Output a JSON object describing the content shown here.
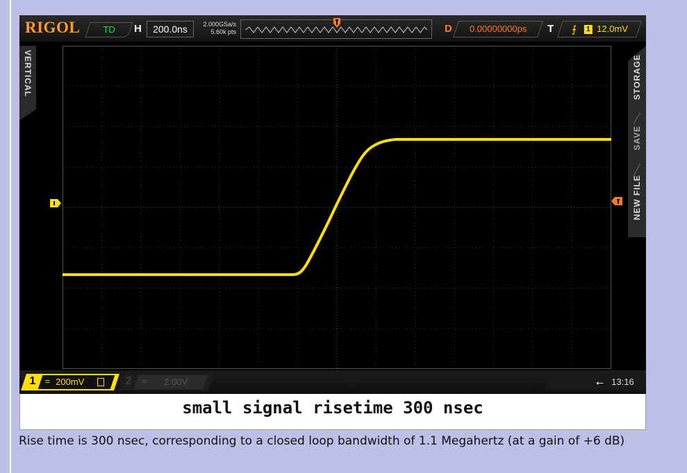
{
  "scope": {
    "brand": "RIGOL",
    "run_status": "TD",
    "horizontal": {
      "key": "H",
      "timebase": "200.0ns",
      "sample_rate": "2.000GSa/s",
      "memory_depth": "5.60k pts"
    },
    "delay": {
      "key": "D",
      "value": "0.00000000ps"
    },
    "trigger": {
      "key": "T",
      "edge_icon": "rising-edge-icon",
      "channel": "1",
      "level": "12.0mV"
    },
    "side_left_label": "VERTICAL",
    "side_right_labels": [
      "STORAGE",
      "SAVE",
      "NEW FILE"
    ],
    "channel1": {
      "number": "1",
      "coupling": "=",
      "scale": "200mV",
      "bw_icon": "bandwidth-limit-icon",
      "color": "#ffe000"
    },
    "channel2": {
      "number": "2",
      "coupling": "=",
      "scale": "2.00V"
    },
    "usb_icon": "usb-icon",
    "clock": "13:16",
    "trigger_color": "#ff7a1a"
  },
  "caption": "small signal risetime 300 nsec",
  "description": "Rise time is 300 nsec, corresponding to a closed loop bandwidth of 1.1 Megahertz (at a gain of +6 dB)"
}
